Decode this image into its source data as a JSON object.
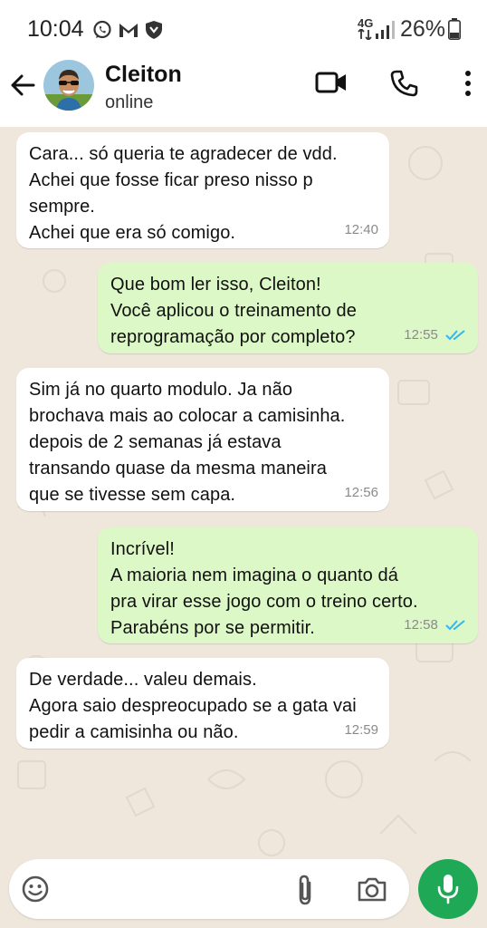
{
  "status_bar": {
    "time": "10:04",
    "network": "4G",
    "battery": "26%",
    "icons": [
      "whatsapp-icon",
      "gmail-icon",
      "shield-icon",
      "signal-icon",
      "battery-icon"
    ]
  },
  "header": {
    "contact_name": "Cleiton",
    "contact_status": "online",
    "icons": [
      "back-arrow-icon",
      "video-call-icon",
      "phone-call-icon",
      "more-options-icon"
    ]
  },
  "messages": [
    {
      "direction": "in",
      "text": "Cara... só queria te agradecer de vdd.\nAchei que fosse ficar preso nisso p\nsempre.\nAchei que era só comigo.",
      "time": "12:40"
    },
    {
      "direction": "out",
      "text": "Que bom ler isso, Cleiton!\nVocê aplicou o treinamento de\nreprogramação por completo?",
      "time": "12:55",
      "read": true
    },
    {
      "direction": "in",
      "text": "Sim já no quarto modulo. Ja não\nbrochava mais ao colocar a camisinha.\ndepois de 2 semanas já estava\ntransando quase da mesma maneira\nque se tivesse sem capa.",
      "time": "12:56"
    },
    {
      "direction": "out",
      "text": "Incrível!\nA maioria nem imagina o quanto dá\npra virar esse jogo com o treino certo.\nParabéns por se permitir.",
      "time": "12:58",
      "read": true
    },
    {
      "direction": "in",
      "text": "De verdade... valeu demais.\nAgora saio despreocupado se a gata vai\npedir a camisinha ou não.",
      "time": "12:59"
    }
  ],
  "composer": {
    "icons": [
      "emoji-icon",
      "attach-icon",
      "camera-icon",
      "mic-icon"
    ]
  },
  "colors": {
    "outgoing_bubble": "#dcf8c6",
    "incoming_bubble": "#ffffff",
    "chat_background": "#efe7dc",
    "read_ticks": "#34b7f1",
    "mic_button": "#1fa855"
  }
}
